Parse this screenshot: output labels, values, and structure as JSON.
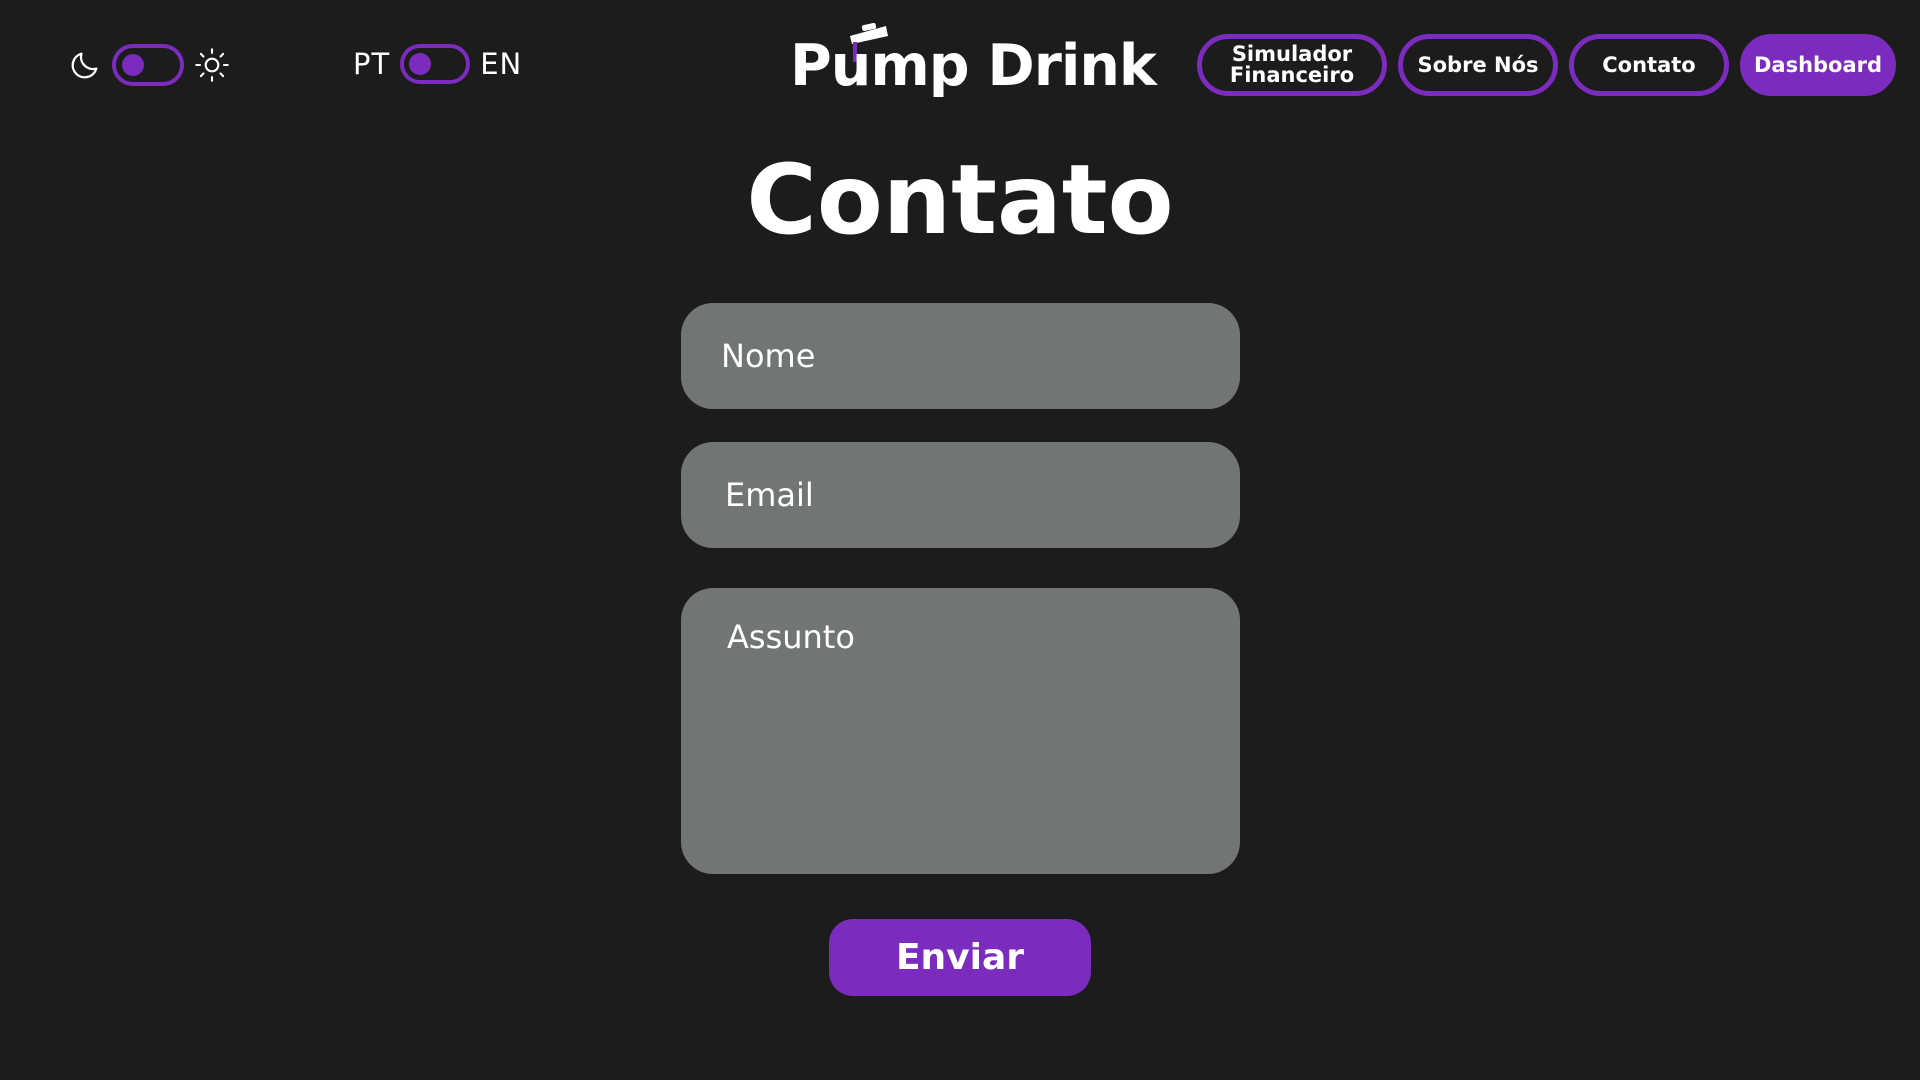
{
  "header": {
    "theme_toggle": {
      "left_icon": "moon-icon",
      "right_icon": "sun-icon",
      "state": "dark"
    },
    "language_toggle": {
      "left_label": "PT",
      "right_label": "EN",
      "state": "PT"
    },
    "logo_text": "Pump Drink",
    "nav": {
      "simulator_line1": "Simulador",
      "simulator_line2": "Financeiro",
      "about": "Sobre Nós",
      "contact": "Contato",
      "dashboard": "Dashboard"
    }
  },
  "main": {
    "title": "Contato",
    "form": {
      "name_placeholder": "Nome",
      "email_placeholder": "Email",
      "subject_placeholder": "Assunto",
      "submit_label": "Enviar"
    }
  },
  "colors": {
    "background": "#1c1c1c",
    "accent": "#7b2bbe",
    "field": "#717574",
    "text": "#ffffff"
  }
}
